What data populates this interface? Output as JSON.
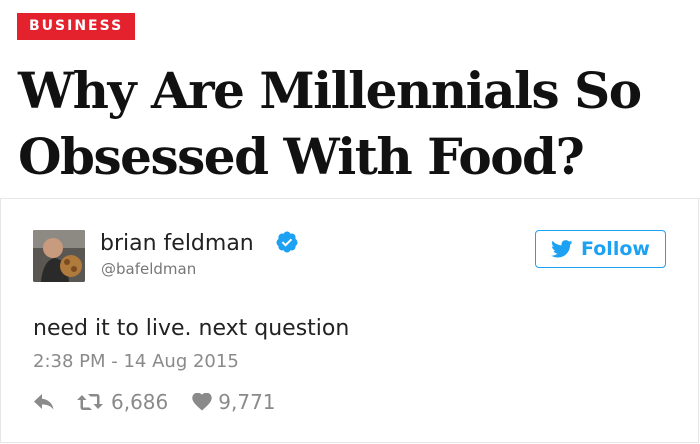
{
  "article": {
    "category": "BUSINESS",
    "headline": "Why Are Millennials So Obsessed With Food?"
  },
  "tweet": {
    "author_name": "brian feldman",
    "author_handle": "@bafeldman",
    "follow_label": "Follow",
    "text": "need it to live. next question",
    "timestamp": "2:38 PM - 14 Aug 2015",
    "retweets": "6,686",
    "likes": "9,771"
  },
  "colors": {
    "badge": "#e4222e",
    "twitter_blue": "#1da1f2",
    "muted": "#8a8a8a"
  },
  "icons": [
    "verified-badge-icon",
    "twitter-bird-icon",
    "reply-icon",
    "retweet-icon",
    "heart-icon"
  ]
}
